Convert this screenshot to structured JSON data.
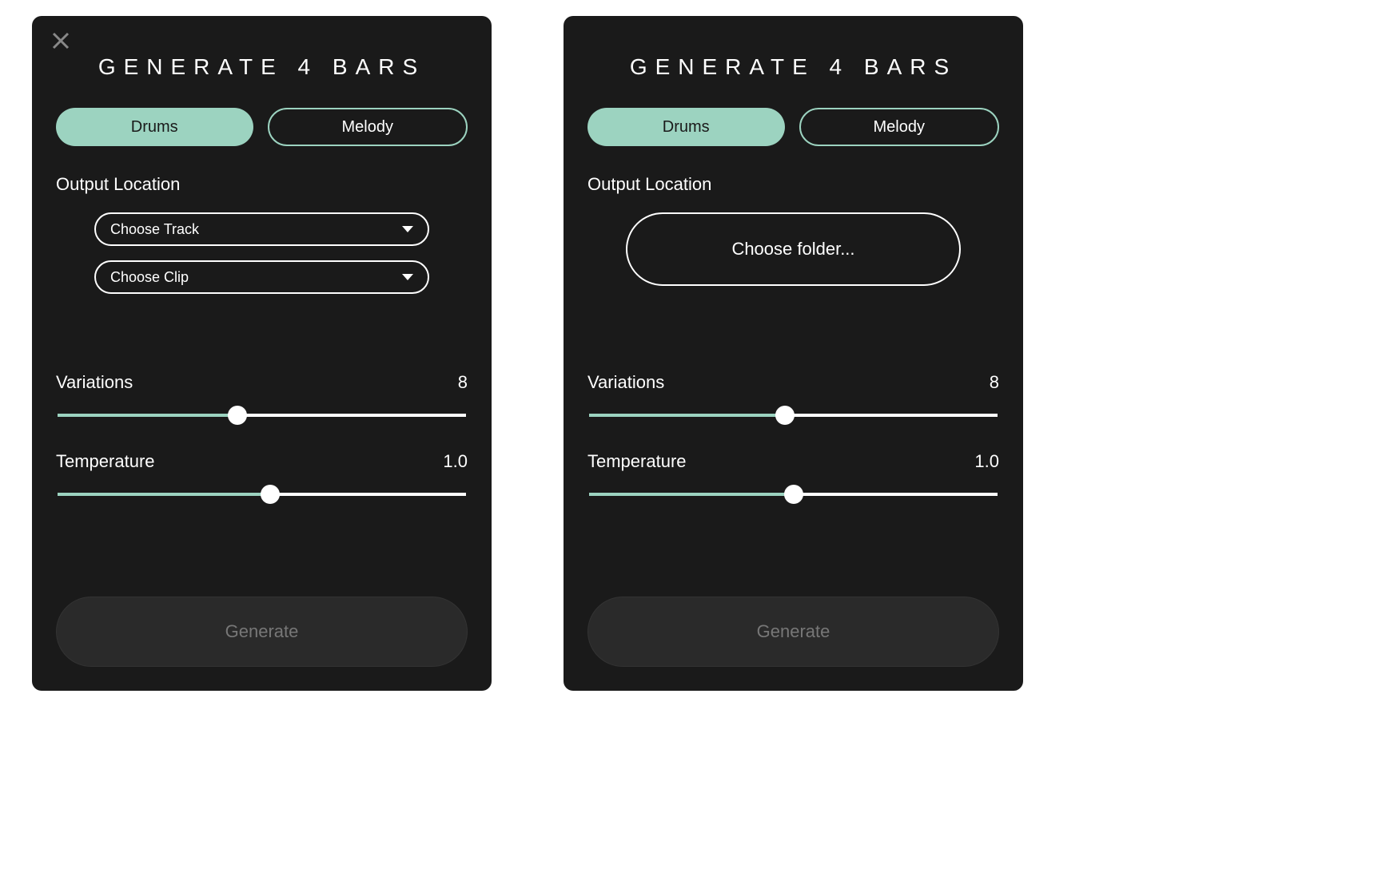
{
  "accent_color": "#9cd3c0",
  "panels": [
    {
      "title": "GENERATE 4 BARS",
      "has_close": true,
      "tabs": {
        "drums": "Drums",
        "melody": "Melody",
        "active": "drums"
      },
      "output_label": "Output Location",
      "output_mode": "dropdowns",
      "dropdowns": [
        "Choose Track",
        "Choose Clip"
      ],
      "sliders": {
        "variations": {
          "label": "Variations",
          "value": "8",
          "fill_pct": 44
        },
        "temperature": {
          "label": "Temperature",
          "value": "1.0",
          "fill_pct": 52
        }
      },
      "generate_label": "Generate"
    },
    {
      "title": "GENERATE 4 BARS",
      "has_close": false,
      "tabs": {
        "drums": "Drums",
        "melody": "Melody",
        "active": "drums"
      },
      "output_label": "Output Location",
      "output_mode": "folder",
      "folder_button": "Choose folder...",
      "sliders": {
        "variations": {
          "label": "Variations",
          "value": "8",
          "fill_pct": 48
        },
        "temperature": {
          "label": "Temperature",
          "value": "1.0",
          "fill_pct": 50
        }
      },
      "generate_label": "Generate"
    }
  ]
}
